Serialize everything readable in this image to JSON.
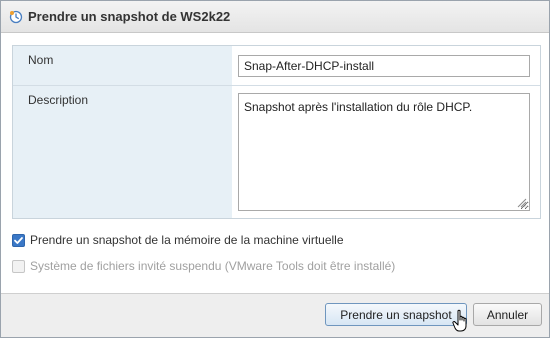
{
  "dialog": {
    "title": "Prendre un snapshot de WS2k22",
    "title_icon": "snapshot-icon"
  },
  "form": {
    "name_label": "Nom",
    "name_value": "Snap-After-DHCP-install",
    "description_label": "Description",
    "description_value": "Snapshot après l'installation du rôle DHCP."
  },
  "options": {
    "memory_label": "Prendre un snapshot de la mémoire de la machine virtuelle",
    "memory_checked": true,
    "quiesce_label": "Système de fichiers invité suspendu (VMware Tools doit être installé)",
    "quiesce_checked": false,
    "quiesce_enabled": false
  },
  "footer": {
    "ok_label": "Prendre un snapshot",
    "cancel_label": "Annuler"
  },
  "colors": {
    "accent": "#3a78c7",
    "label_background": "#e7f0f6",
    "disabled_text": "#a0a0a0"
  }
}
